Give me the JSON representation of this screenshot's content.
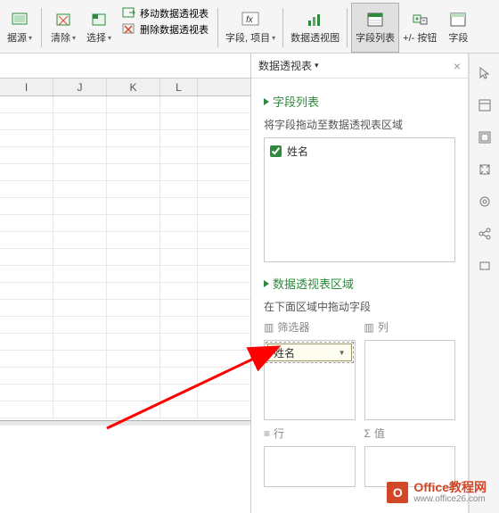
{
  "ribbon": {
    "data_source": "据源",
    "clear": "清除",
    "select": "选择",
    "move_pivot": "移动数据透视表",
    "delete_pivot": "删除数据透视表",
    "fields_items": "字段, 项目",
    "pivot_chart": "数据透视图",
    "field_list": "字段列表",
    "plus_minus": "+/- 按钮",
    "field_headers": "字段"
  },
  "columns": [
    "I",
    "J",
    "K",
    "L"
  ],
  "pane": {
    "title": "数据透视表",
    "field_list_title": "字段列表",
    "drag_hint": "将字段拖动至数据透视表区域",
    "field_name": "姓名",
    "areas_title": "数据透视表区域",
    "areas_hint": "在下面区域中拖动字段",
    "filters": "筛选器",
    "columns_area": "列",
    "rows_area": "行",
    "values_area": "值",
    "filter_chip": "姓名"
  },
  "watermark": {
    "title": "Office教程网",
    "url": "www.office26.com"
  }
}
